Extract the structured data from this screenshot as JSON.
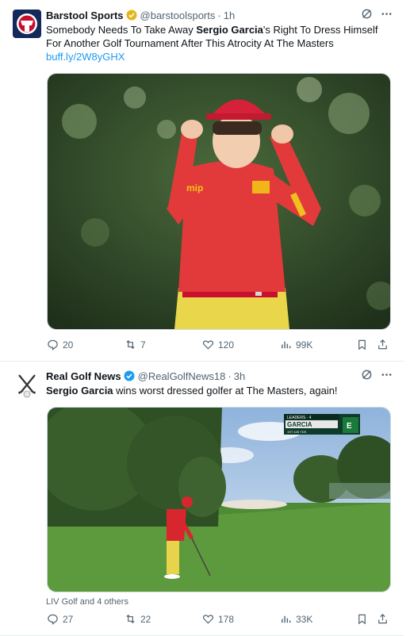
{
  "tweets": [
    {
      "name": "Barstool Sports",
      "handle": "@barstoolsports",
      "sep": "·",
      "time": "1h",
      "text_pre": "Somebody Needs To Take Away ",
      "text_bold": "Sergio Garcia",
      "text_post": "'s Right To Dress Himself For Another Golf Tournament After This Atrocity At The Masters",
      "link": "buff.ly/2W8yGHX",
      "badge_color": "#e2b719",
      "actions": {
        "replies": "20",
        "reposts": "7",
        "likes": "120",
        "views": "99K"
      }
    },
    {
      "name": "Real Golf News",
      "handle": "@RealGolfNews18",
      "sep": "·",
      "time": "3h",
      "text_bold": "Sergio Garcia",
      "text_post": " wins worst dressed golfer at The Masters, again!",
      "badge_color": "#1d9bf0",
      "leaderboard": {
        "header": "LEADERS · 4",
        "player": "GARCIA",
        "score": "E",
        "row": "1ST   445 YDS"
      },
      "social_context": "LIV Golf and 4 others",
      "actions": {
        "replies": "27",
        "reposts": "22",
        "likes": "178",
        "views": "33K"
      }
    }
  ],
  "colors": {
    "muted": "#536471",
    "link": "#1d9bf0",
    "text": "#0f1419"
  }
}
